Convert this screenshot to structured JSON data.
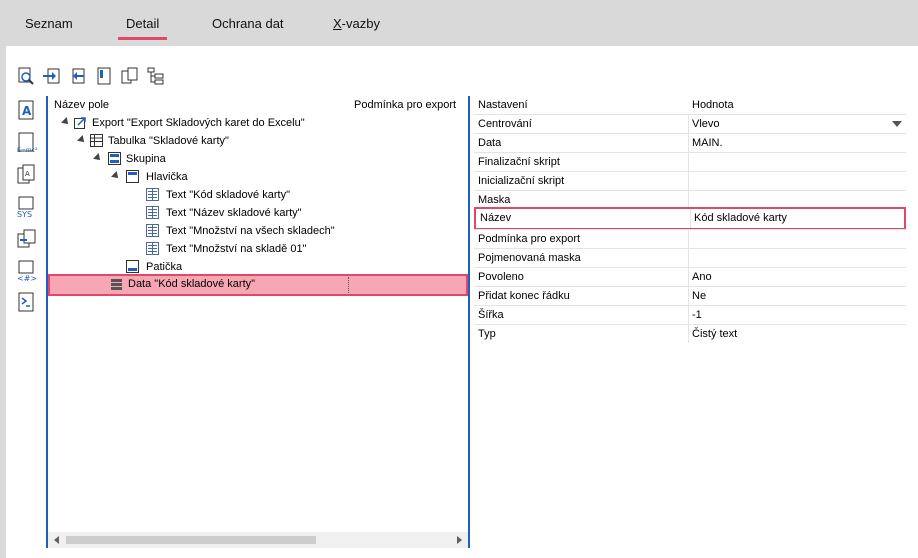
{
  "tabs": [
    {
      "label": "Seznam"
    },
    {
      "label": "Detail"
    },
    {
      "label": "Ochrana dat"
    },
    {
      "label_first": "X",
      "label_rest": "-vazby"
    }
  ],
  "toolbar_icons": [
    "preview-icon",
    "insert-before-icon",
    "insert-after-icon",
    "page-icon",
    "copy-icon",
    "hierarchy-icon"
  ],
  "side_icons": [
    "user-field-icon",
    "formula-icon",
    "field-icon",
    "system-variable-icon",
    "copy-field-icon",
    "expression-icon",
    "script-icon"
  ],
  "tree": {
    "col_name": "Název pole",
    "col_condition": "Podmínka pro export",
    "nodes": [
      {
        "label": "Export \"Export Skladových karet do Excelu\"",
        "icon": "export-icon"
      },
      {
        "label": "Tabulka \"Skladové karty\"",
        "icon": "table-icon"
      },
      {
        "label": "Skupina",
        "icon": "group-icon"
      },
      {
        "label": "Hlavička",
        "icon": "header-icon"
      },
      {
        "label": "Text \"Kód skladové karty\"",
        "icon": "text-field-icon"
      },
      {
        "label": "Text \"Název skladové karty\"",
        "icon": "text-field-icon"
      },
      {
        "label": "Text \"Množství na všech skladech\"",
        "icon": "text-field-icon"
      },
      {
        "label": "Text \"Množství na skladě 01\"",
        "icon": "text-field-icon"
      },
      {
        "label": "Patička",
        "icon": "footer-icon"
      },
      {
        "label": "Data \"Kód skladové karty\"",
        "icon": "data-field-icon"
      }
    ]
  },
  "properties": {
    "col_setting": "Nastavení",
    "col_value": "Hodnota",
    "rows": [
      {
        "key": "Centrování",
        "value": "Vlevo"
      },
      {
        "key": "Data",
        "value": "MAIN."
      },
      {
        "key": "Finalizační skript",
        "value": ""
      },
      {
        "key": "Inicializační skript",
        "value": ""
      },
      {
        "key": "Maska",
        "value": ""
      },
      {
        "key": "Název",
        "value": "Kód skladové karty"
      },
      {
        "key": "Podmínka pro export",
        "value": ""
      },
      {
        "key": "Pojmenovaná maska",
        "value": ""
      },
      {
        "key": "Povoleno",
        "value": "Ano"
      },
      {
        "key": "Přidat konec řádku",
        "value": "Ne"
      },
      {
        "key": "Šířka",
        "value": "-1"
      },
      {
        "key": "Typ",
        "value": "Čistý text"
      }
    ]
  },
  "colors": {
    "accent": "#e0486a",
    "selection": "#f7a7b4",
    "pane_border": "#1f5fbf"
  }
}
